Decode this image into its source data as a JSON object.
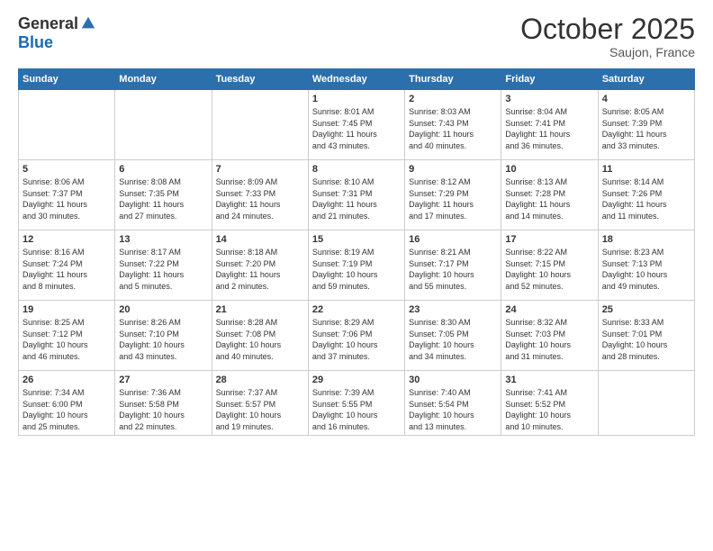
{
  "logo": {
    "general": "General",
    "blue": "Blue"
  },
  "header": {
    "month": "October 2025",
    "location": "Saujon, France"
  },
  "days_of_week": [
    "Sunday",
    "Monday",
    "Tuesday",
    "Wednesday",
    "Thursday",
    "Friday",
    "Saturday"
  ],
  "weeks": [
    [
      {
        "day": "",
        "info": ""
      },
      {
        "day": "",
        "info": ""
      },
      {
        "day": "",
        "info": ""
      },
      {
        "day": "1",
        "info": "Sunrise: 8:01 AM\nSunset: 7:45 PM\nDaylight: 11 hours\nand 43 minutes."
      },
      {
        "day": "2",
        "info": "Sunrise: 8:03 AM\nSunset: 7:43 PM\nDaylight: 11 hours\nand 40 minutes."
      },
      {
        "day": "3",
        "info": "Sunrise: 8:04 AM\nSunset: 7:41 PM\nDaylight: 11 hours\nand 36 minutes."
      },
      {
        "day": "4",
        "info": "Sunrise: 8:05 AM\nSunset: 7:39 PM\nDaylight: 11 hours\nand 33 minutes."
      }
    ],
    [
      {
        "day": "5",
        "info": "Sunrise: 8:06 AM\nSunset: 7:37 PM\nDaylight: 11 hours\nand 30 minutes."
      },
      {
        "day": "6",
        "info": "Sunrise: 8:08 AM\nSunset: 7:35 PM\nDaylight: 11 hours\nand 27 minutes."
      },
      {
        "day": "7",
        "info": "Sunrise: 8:09 AM\nSunset: 7:33 PM\nDaylight: 11 hours\nand 24 minutes."
      },
      {
        "day": "8",
        "info": "Sunrise: 8:10 AM\nSunset: 7:31 PM\nDaylight: 11 hours\nand 21 minutes."
      },
      {
        "day": "9",
        "info": "Sunrise: 8:12 AM\nSunset: 7:29 PM\nDaylight: 11 hours\nand 17 minutes."
      },
      {
        "day": "10",
        "info": "Sunrise: 8:13 AM\nSunset: 7:28 PM\nDaylight: 11 hours\nand 14 minutes."
      },
      {
        "day": "11",
        "info": "Sunrise: 8:14 AM\nSunset: 7:26 PM\nDaylight: 11 hours\nand 11 minutes."
      }
    ],
    [
      {
        "day": "12",
        "info": "Sunrise: 8:16 AM\nSunset: 7:24 PM\nDaylight: 11 hours\nand 8 minutes."
      },
      {
        "day": "13",
        "info": "Sunrise: 8:17 AM\nSunset: 7:22 PM\nDaylight: 11 hours\nand 5 minutes."
      },
      {
        "day": "14",
        "info": "Sunrise: 8:18 AM\nSunset: 7:20 PM\nDaylight: 11 hours\nand 2 minutes."
      },
      {
        "day": "15",
        "info": "Sunrise: 8:19 AM\nSunset: 7:19 PM\nDaylight: 10 hours\nand 59 minutes."
      },
      {
        "day": "16",
        "info": "Sunrise: 8:21 AM\nSunset: 7:17 PM\nDaylight: 10 hours\nand 55 minutes."
      },
      {
        "day": "17",
        "info": "Sunrise: 8:22 AM\nSunset: 7:15 PM\nDaylight: 10 hours\nand 52 minutes."
      },
      {
        "day": "18",
        "info": "Sunrise: 8:23 AM\nSunset: 7:13 PM\nDaylight: 10 hours\nand 49 minutes."
      }
    ],
    [
      {
        "day": "19",
        "info": "Sunrise: 8:25 AM\nSunset: 7:12 PM\nDaylight: 10 hours\nand 46 minutes."
      },
      {
        "day": "20",
        "info": "Sunrise: 8:26 AM\nSunset: 7:10 PM\nDaylight: 10 hours\nand 43 minutes."
      },
      {
        "day": "21",
        "info": "Sunrise: 8:28 AM\nSunset: 7:08 PM\nDaylight: 10 hours\nand 40 minutes."
      },
      {
        "day": "22",
        "info": "Sunrise: 8:29 AM\nSunset: 7:06 PM\nDaylight: 10 hours\nand 37 minutes."
      },
      {
        "day": "23",
        "info": "Sunrise: 8:30 AM\nSunset: 7:05 PM\nDaylight: 10 hours\nand 34 minutes."
      },
      {
        "day": "24",
        "info": "Sunrise: 8:32 AM\nSunset: 7:03 PM\nDaylight: 10 hours\nand 31 minutes."
      },
      {
        "day": "25",
        "info": "Sunrise: 8:33 AM\nSunset: 7:01 PM\nDaylight: 10 hours\nand 28 minutes."
      }
    ],
    [
      {
        "day": "26",
        "info": "Sunrise: 7:34 AM\nSunset: 6:00 PM\nDaylight: 10 hours\nand 25 minutes."
      },
      {
        "day": "27",
        "info": "Sunrise: 7:36 AM\nSunset: 5:58 PM\nDaylight: 10 hours\nand 22 minutes."
      },
      {
        "day": "28",
        "info": "Sunrise: 7:37 AM\nSunset: 5:57 PM\nDaylight: 10 hours\nand 19 minutes."
      },
      {
        "day": "29",
        "info": "Sunrise: 7:39 AM\nSunset: 5:55 PM\nDaylight: 10 hours\nand 16 minutes."
      },
      {
        "day": "30",
        "info": "Sunrise: 7:40 AM\nSunset: 5:54 PM\nDaylight: 10 hours\nand 13 minutes."
      },
      {
        "day": "31",
        "info": "Sunrise: 7:41 AM\nSunset: 5:52 PM\nDaylight: 10 hours\nand 10 minutes."
      },
      {
        "day": "",
        "info": ""
      }
    ]
  ]
}
